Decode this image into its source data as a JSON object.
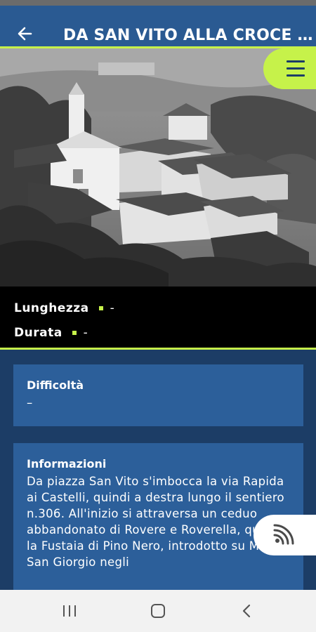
{
  "app_bar": {
    "title": "DA SAN VITO ALLA CROCE DE...",
    "back_icon": "arrow-left-icon"
  },
  "hero": {
    "description_icon": "hero-photo"
  },
  "meta": {
    "length_label": "Lunghezza",
    "length_value": "-",
    "duration_label": "Durata",
    "duration_value": "-"
  },
  "cards": {
    "difficulty": {
      "title": "Difficoltà",
      "value": "–"
    },
    "info": {
      "title": "Informazioni",
      "text": "Da piazza San Vito s'imbocca la via Rapida ai Castelli, quindi a destra lungo il sentiero n.306. All'inizio si attraversa un ceduo abbandonato di Rovere e Roverella, quindi la Fustaia di Pino Nero, introdotto su Monte San Giorgio negli"
    }
  },
  "colors": {
    "brand_blue": "#2a5a92",
    "accent": "#c6f24a",
    "dark_blue": "#1c3d66"
  }
}
